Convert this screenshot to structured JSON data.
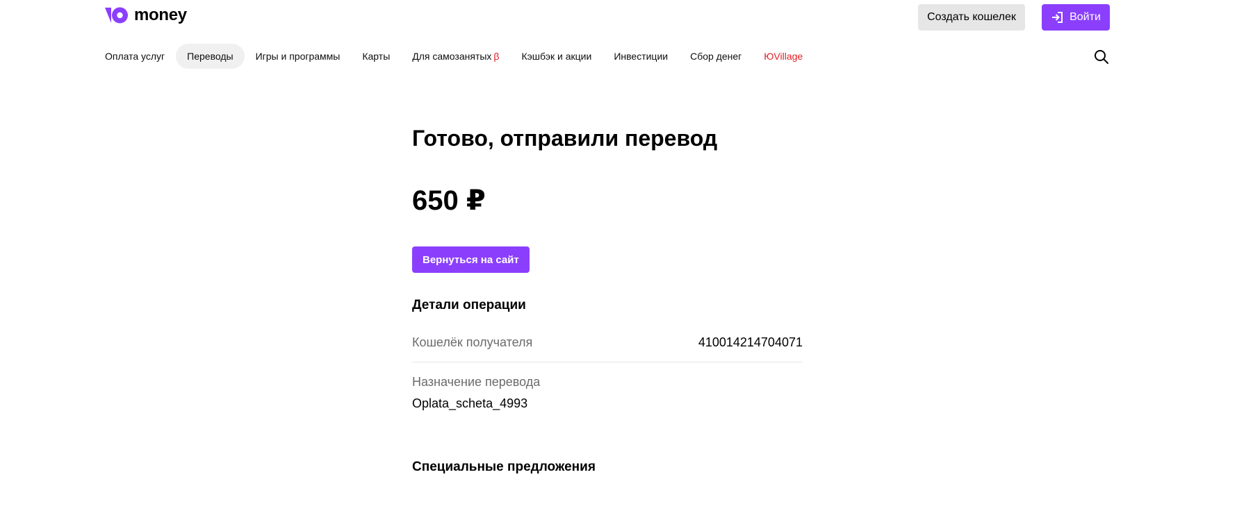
{
  "header": {
    "logo_text": "money",
    "create_wallet_label": "Создать кошелек",
    "login_label": "Войти"
  },
  "nav": {
    "items": [
      {
        "label": "Оплата услуг"
      },
      {
        "label": "Переводы",
        "active": true
      },
      {
        "label": "Игры и программы"
      },
      {
        "label": "Карты"
      },
      {
        "label": "Для самозанятых",
        "badge": "β"
      },
      {
        "label": "Кэшбэк и акции"
      },
      {
        "label": "Инвестиции"
      },
      {
        "label": "Сбор денег"
      },
      {
        "label": "ЮVillage"
      }
    ]
  },
  "main": {
    "title": "Готово, отправили перевод",
    "amount": "650 ₽",
    "back_button_label": "Вернуться на сайт",
    "details_title": "Детали операции",
    "wallet_label": "Кошелёк получателя",
    "wallet_value": "410014214704071",
    "purpose_label": "Назначение перевода",
    "purpose_value": "Oplata_scheta_4993",
    "offers_title": "Специальные предложения"
  },
  "colors": {
    "brand_purple": "#8b3ffd",
    "accent_red": "#e31e24",
    "nav_active_bg": "#f0f0f0",
    "secondary_button_bg": "#e6e6e6"
  },
  "icons": {
    "logo": "yoomoney-logo-icon",
    "login": "login-arrow-icon",
    "search": "search-icon"
  }
}
